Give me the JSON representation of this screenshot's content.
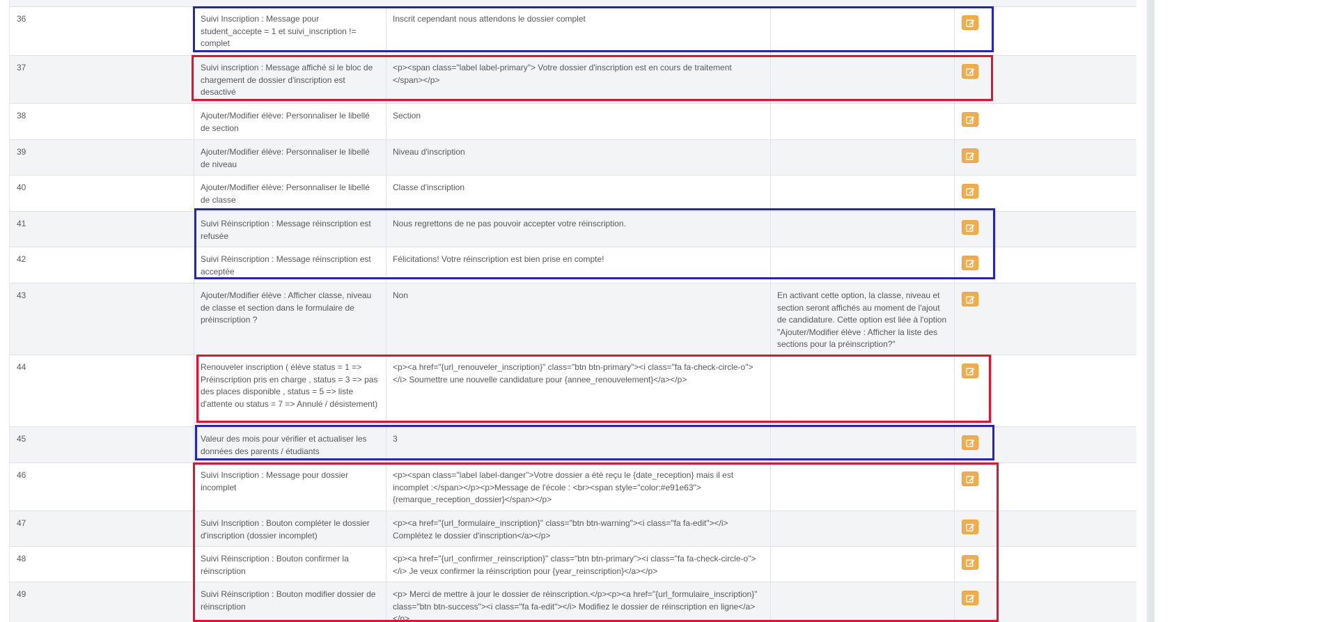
{
  "table": {
    "rows": [
      {
        "id": "36",
        "description": "Suivi Inscription : Message pour student_accepte = 1 et suivi_inscription != complet",
        "value": "Inscrit cependant nous attendons le dossier complet",
        "note": ""
      },
      {
        "id": "37",
        "description": "Suivi inscription : Message affiché si le bloc de chargement de dossier d'inscription est desactivé",
        "value": "<p><span class=\"label label-primary\"> Votre dossier d'inscription est en cours de traitement </span></p>",
        "note": ""
      },
      {
        "id": "38",
        "description": "Ajouter/Modifier élève: Personnaliser le libellé de section",
        "value": "Section",
        "note": ""
      },
      {
        "id": "39",
        "description": "Ajouter/Modifier élève: Personnaliser le libellé de niveau",
        "value": "Niveau d'inscription",
        "note": ""
      },
      {
        "id": "40",
        "description": "Ajouter/Modifier élève: Personnaliser le libellé de classe",
        "value": "Classe d'inscription",
        "note": ""
      },
      {
        "id": "41",
        "description": "Suivi Réinscription : Message réinscription est refusée",
        "value": "Nous regrettons de ne pas pouvoir accepter votre réinscription.",
        "note": ""
      },
      {
        "id": "42",
        "description": "Suivi Réinscription : Message réinscription est acceptée",
        "value": "Félicitations! Votre réinscription est bien prise en compte!",
        "note": ""
      },
      {
        "id": "43",
        "description": "Ajouter/Modifier élève : Afficher classe, niveau de classe et section dans le formulaire de préinscription ?",
        "value": "Non",
        "note": "En activant cette option, la classe, niveau et section seront affichés au moment de l'ajout de candidature. Cette option est liée à l'option \"Ajouter/Modifier élève : Afficher la liste des sections pour la préinscription?\""
      },
      {
        "id": "44",
        "description": "Renouveler inscription ( élève status = 1 => Préinscription pris en charge , status = 3 => pas des places disponible , status = 5 => liste d'attente ou status = 7 => Annulé / désistement)",
        "value": "<p><a href=\"{url_renouveler_inscription}\" class=\"btn btn-primary\"><i class=\"fa fa-check-circle-o\"></i> Soumettre une nouvelle candidature pour {annee_renouvelement}</a></p>",
        "note": ""
      },
      {
        "id": "45",
        "description": "Valeur des mois pour vérifier et actualiser les données des parents / étudiants",
        "value": "3",
        "note": ""
      },
      {
        "id": "46",
        "description": "Suivi Inscription : Message pour dossier incomplet",
        "value": "<p><span class=\"label label-danger\">Votre dossier a été reçu le {date_reception} mais il est incomplet :</span></p><p>Message de l'école : <br><span style=\"color:#e91e63\">{remarque_reception_dossier}</span></p>",
        "note": ""
      },
      {
        "id": "47",
        "description": "Suivi Inscription : Bouton compléter le dossier d'inscription (dossier incomplet)",
        "value": "<p><a href=\"{url_formulaire_inscription}\" class=\"btn btn-warning\"><i class=\"fa fa-edit\"></i> Complétez le dossier d'inscription</a></p>",
        "note": ""
      },
      {
        "id": "48",
        "description": "Suivi Réinscription : Bouton confirmer la réinscription",
        "value": "<p><a href=\"{url_confirmer_reinscription}\" class=\"btn btn-primary\"><i class=\"fa fa-check-circle-o\"></i> Je veux confirmer la réinscription pour {year_reinscription}</a></p>",
        "note": ""
      },
      {
        "id": "49",
        "description": "Suivi Réinscription : Bouton modifier dossier de réinscription",
        "value": "<p> Merci de mettre à jour le dossier de réinscription.</p><p><a href=\"{url_formulaire_inscription}\" class=\"btn btn-success\"><i class=\"fa fa-edit\"></i> Modifiez le dossier de réinscription en ligne</a></p>",
        "note": ""
      }
    ]
  },
  "icons": {
    "edit": "edit-icon"
  },
  "colors": {
    "edit_button": "#f0ad4e",
    "highlight_blue": "#2323c8",
    "highlight_red": "#e8102a"
  }
}
